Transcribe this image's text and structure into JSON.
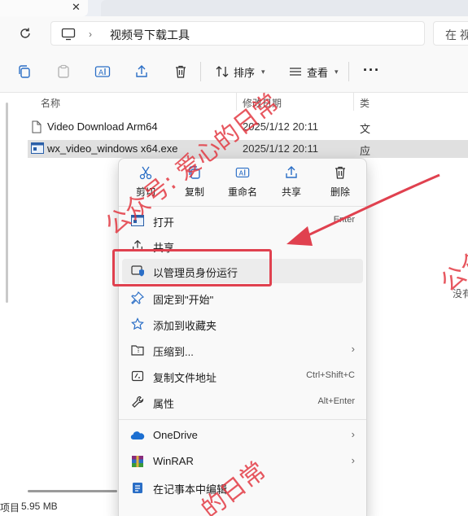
{
  "tabstrip": {
    "close_glyph": "✕"
  },
  "address": {
    "path": "视频号下载工具",
    "search_placeholder": "在 视"
  },
  "toolbar": {
    "sort_label": "排序",
    "view_label": "查看",
    "icons": [
      "copy-icon",
      "paste-icon",
      "rename-icon",
      "share-icon",
      "delete-icon",
      "sort-icon",
      "view-icon",
      "more-icon"
    ]
  },
  "filelist": {
    "columns": {
      "name": "名称",
      "date": "修改日期",
      "type": "类"
    },
    "rows": [
      {
        "name": "Video Download Arm64",
        "date": "2025/1/12 20:11",
        "type": "文"
      },
      {
        "name": "wx_video_windows x64.exe",
        "date": "2025/1/12 20:11",
        "type": "应"
      }
    ]
  },
  "status": {
    "items": "项目",
    "size": "5.95 MB"
  },
  "context_menu": {
    "quick_actions": [
      {
        "label": "剪切",
        "icon": "cut-icon"
      },
      {
        "label": "复制",
        "icon": "copy-icon"
      },
      {
        "label": "重命名",
        "icon": "rename-icon"
      },
      {
        "label": "共享",
        "icon": "share-icon"
      },
      {
        "label": "删除",
        "icon": "delete-icon"
      }
    ],
    "items": [
      {
        "label": "打开",
        "shortcut": "Enter",
        "icon": "open-app-icon"
      },
      {
        "label": "共享",
        "shortcut": "",
        "icon": "share-icon"
      },
      {
        "label": "以管理员身份运行",
        "shortcut": "",
        "icon": "admin-shield-icon"
      },
      {
        "label": "固定到\"开始\"",
        "shortcut": "",
        "icon": "pin-icon"
      },
      {
        "label": "添加到收藏夹",
        "shortcut": "",
        "icon": "star-icon"
      },
      {
        "label": "压缩到...",
        "shortcut": "",
        "icon": "zip-folder-icon"
      },
      {
        "label": "复制文件地址",
        "shortcut": "Ctrl+Shift+C",
        "icon": "copy-path-icon"
      },
      {
        "label": "属性",
        "shortcut": "Alt+Enter",
        "icon": "wrench-icon"
      },
      {
        "label": "OneDrive",
        "shortcut": "",
        "icon": "onedrive-icon"
      },
      {
        "label": "WinRAR",
        "shortcut": "",
        "icon": "winrar-icon"
      },
      {
        "label": "在记事本中编辑",
        "shortcut": "",
        "icon": "notepad-icon"
      }
    ],
    "submenu_glyph": "›"
  },
  "watermarks": [
    "公众号: 爱心的日常",
    "公众",
    "没有",
    "的日常"
  ],
  "colors": {
    "accent": "#0067c0",
    "highlight": "#e0414f",
    "watermark": "#e2323c"
  }
}
